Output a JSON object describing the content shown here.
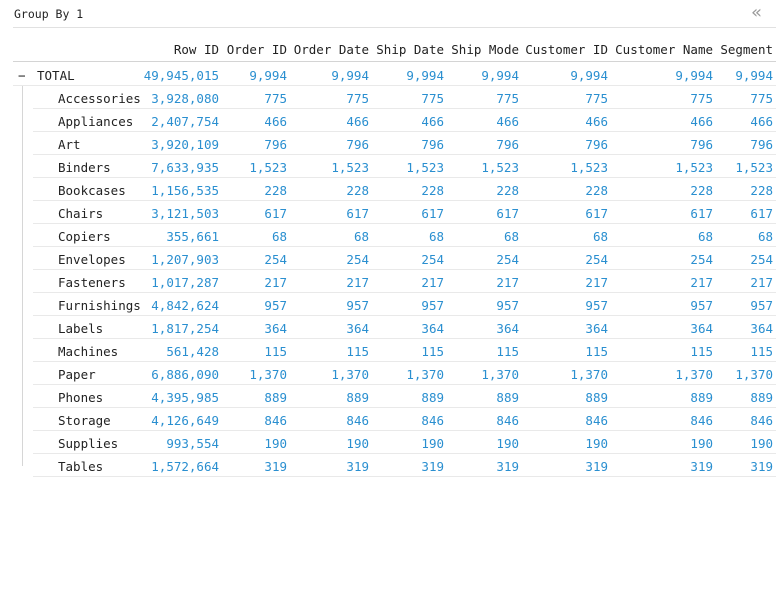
{
  "panel": {
    "title": "Group By 1",
    "collapse_icon": "«"
  },
  "columns": [
    "Row ID",
    "Order ID",
    "Order Date",
    "Ship Date",
    "Ship Mode",
    "Customer ID",
    "Customer Name",
    "Segment"
  ],
  "total": {
    "toggle": "−",
    "label": "TOTAL",
    "values": [
      "49,945,015",
      "9,994",
      "9,994",
      "9,994",
      "9,994",
      "9,994",
      "9,994",
      "9,994"
    ]
  },
  "rows": [
    {
      "label": "Accessories",
      "values": [
        "3,928,080",
        "775",
        "775",
        "775",
        "775",
        "775",
        "775",
        "775"
      ]
    },
    {
      "label": "Appliances",
      "values": [
        "2,407,754",
        "466",
        "466",
        "466",
        "466",
        "466",
        "466",
        "466"
      ]
    },
    {
      "label": "Art",
      "values": [
        "3,920,109",
        "796",
        "796",
        "796",
        "796",
        "796",
        "796",
        "796"
      ]
    },
    {
      "label": "Binders",
      "values": [
        "7,633,935",
        "1,523",
        "1,523",
        "1,523",
        "1,523",
        "1,523",
        "1,523",
        "1,523"
      ]
    },
    {
      "label": "Bookcases",
      "values": [
        "1,156,535",
        "228",
        "228",
        "228",
        "228",
        "228",
        "228",
        "228"
      ]
    },
    {
      "label": "Chairs",
      "values": [
        "3,121,503",
        "617",
        "617",
        "617",
        "617",
        "617",
        "617",
        "617"
      ]
    },
    {
      "label": "Copiers",
      "values": [
        "355,661",
        "68",
        "68",
        "68",
        "68",
        "68",
        "68",
        "68"
      ]
    },
    {
      "label": "Envelopes",
      "values": [
        "1,207,903",
        "254",
        "254",
        "254",
        "254",
        "254",
        "254",
        "254"
      ]
    },
    {
      "label": "Fasteners",
      "values": [
        "1,017,287",
        "217",
        "217",
        "217",
        "217",
        "217",
        "217",
        "217"
      ]
    },
    {
      "label": "Furnishings",
      "values": [
        "4,842,624",
        "957",
        "957",
        "957",
        "957",
        "957",
        "957",
        "957"
      ]
    },
    {
      "label": "Labels",
      "values": [
        "1,817,254",
        "364",
        "364",
        "364",
        "364",
        "364",
        "364",
        "364"
      ]
    },
    {
      "label": "Machines",
      "values": [
        "561,428",
        "115",
        "115",
        "115",
        "115",
        "115",
        "115",
        "115"
      ]
    },
    {
      "label": "Paper",
      "values": [
        "6,886,090",
        "1,370",
        "1,370",
        "1,370",
        "1,370",
        "1,370",
        "1,370",
        "1,370"
      ]
    },
    {
      "label": "Phones",
      "values": [
        "4,395,985",
        "889",
        "889",
        "889",
        "889",
        "889",
        "889",
        "889"
      ]
    },
    {
      "label": "Storage",
      "values": [
        "4,126,649",
        "846",
        "846",
        "846",
        "846",
        "846",
        "846",
        "846"
      ]
    },
    {
      "label": "Supplies",
      "values": [
        "993,554",
        "190",
        "190",
        "190",
        "190",
        "190",
        "190",
        "190"
      ]
    },
    {
      "label": "Tables",
      "values": [
        "1,572,664",
        "319",
        "319",
        "319",
        "319",
        "319",
        "319",
        "319"
      ]
    }
  ],
  "colors": {
    "value": "#2a8fd0",
    "text": "#222222",
    "border": "#e9e9e9"
  }
}
